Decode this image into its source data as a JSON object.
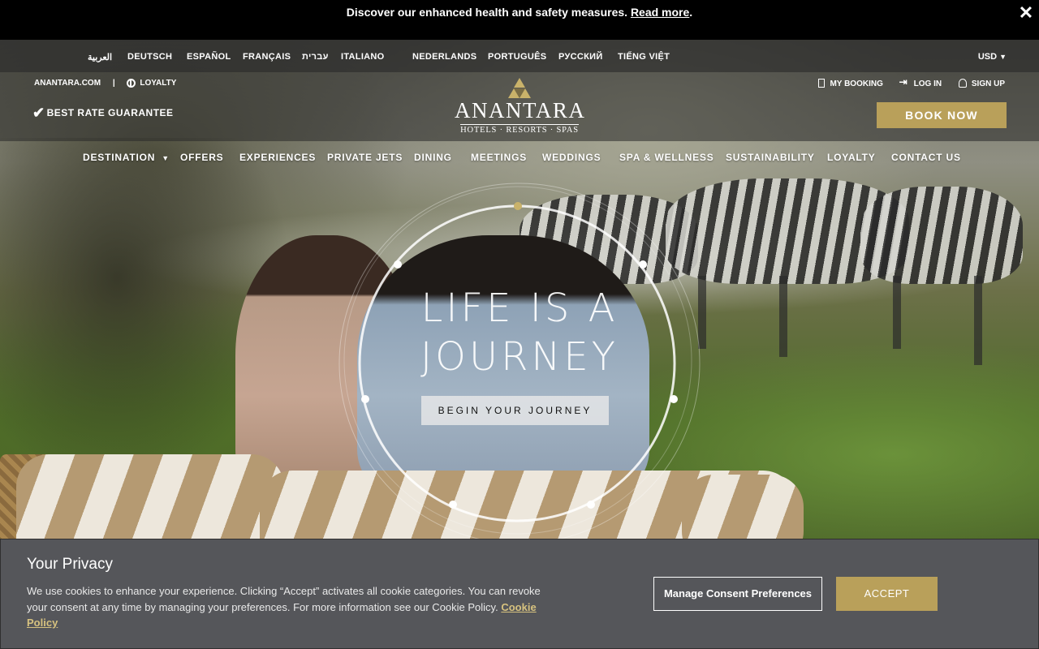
{
  "announce": {
    "text": "Discover our enhanced health and safety measures.",
    "link": "Read more",
    "trail": ".",
    "close_icon": "close-icon"
  },
  "languages": [
    "العربية",
    "DEUTSCH",
    "ESPAÑOL",
    "FRANÇAIS",
    "עברית",
    "ITALIANO",
    "NEDERLANDS",
    "PORTUGUÊS",
    "РУССКИЙ",
    "TIẾNG VIỆT"
  ],
  "currency": "USD",
  "toplinks": {
    "site": "ANANTARA.COM",
    "separator": "|",
    "loyalty": "LOYALTY"
  },
  "account": {
    "my_booking": "MY BOOKING",
    "login": "LOG IN",
    "signup": "SIGN UP"
  },
  "best_rate": "BEST RATE GUARANTEE",
  "logo": {
    "word": "ANANTARA",
    "sub": "HOTELS · RESORTS · SPAS"
  },
  "book_now": "BOOK NOW",
  "nav": [
    "DESTINATION",
    "OFFERS",
    "EXPERIENCES",
    "PRIVATE JETS",
    "DINING",
    "MEETINGS",
    "WEDDINGS",
    "SPA & WELLNESS",
    "SUSTAINABILITY",
    "LOYALTY",
    "CONTACT US"
  ],
  "hero": {
    "line1": "LIFE IS A",
    "line2": "JOURNEY",
    "cta": "BEGIN YOUR JOURNEY"
  },
  "cookie": {
    "title": "Your Privacy",
    "body": "We use cookies to enhance your experience. Clicking “Accept” activates all cookie categories. You can revoke your consent at any time by managing your preferences. For more information see our Cookie Policy.",
    "policy_link": "Cookie Policy",
    "manage": "Manage Consent Preferences",
    "accept": "ACCEPT"
  },
  "colors": {
    "gold": "#b9a05a",
    "announce_bg": "#000000",
    "cookie_bg": "#55565a"
  }
}
